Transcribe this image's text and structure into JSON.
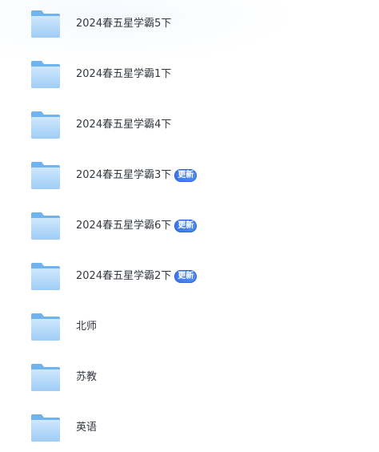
{
  "files": [
    {
      "name": "2024春五星学霸5下",
      "badge": "",
      "icon": "folder-icon"
    },
    {
      "name": "2024春五星学霸1下",
      "badge": "",
      "icon": "folder-icon"
    },
    {
      "name": "2024春五星学霸4下",
      "badge": "",
      "icon": "folder-icon"
    },
    {
      "name": "2024春五星学霸3下",
      "badge": "更新",
      "icon": "folder-icon"
    },
    {
      "name": "2024春五星学霸6下",
      "badge": "更新",
      "icon": "folder-icon"
    },
    {
      "name": "2024春五星学霸2下",
      "badge": "更新",
      "icon": "folder-icon"
    },
    {
      "name": "北师",
      "badge": "",
      "icon": "folder-icon"
    },
    {
      "name": "苏教",
      "badge": "",
      "icon": "folder-icon"
    },
    {
      "name": "英语",
      "badge": "",
      "icon": "folder-icon"
    }
  ],
  "colors": {
    "folder_back": "#6fb4ee",
    "folder_front": "#b7dcfb",
    "badge": "#4680ec",
    "text": "#33383f"
  }
}
